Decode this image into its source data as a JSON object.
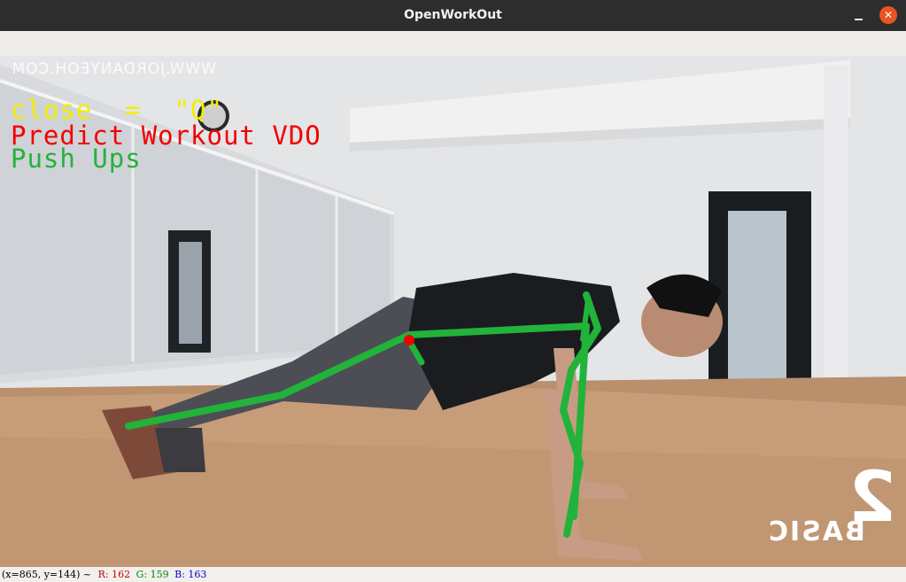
{
  "window": {
    "title": "OpenWorkOut",
    "minimize_glyph": "–",
    "close_glyph": "✕"
  },
  "overlay": {
    "close_hint": "close  =  \"Q\"",
    "mode": "Predict Workout VDO",
    "prediction": "Push Ups",
    "colors": {
      "close_hint": "#f0f000",
      "mode": "#f20000",
      "prediction": "#22b33a",
      "skeleton": "#22b33a",
      "keypoint": "#f00000"
    }
  },
  "video": {
    "watermark": "WWW.JORDANYEOH.COM",
    "brand_number": "2",
    "brand_word": "BASIC"
  },
  "status": {
    "position": "(x=865, y=144) ~",
    "r": "R: 162",
    "g": "G: 159",
    "b": "B: 163"
  }
}
